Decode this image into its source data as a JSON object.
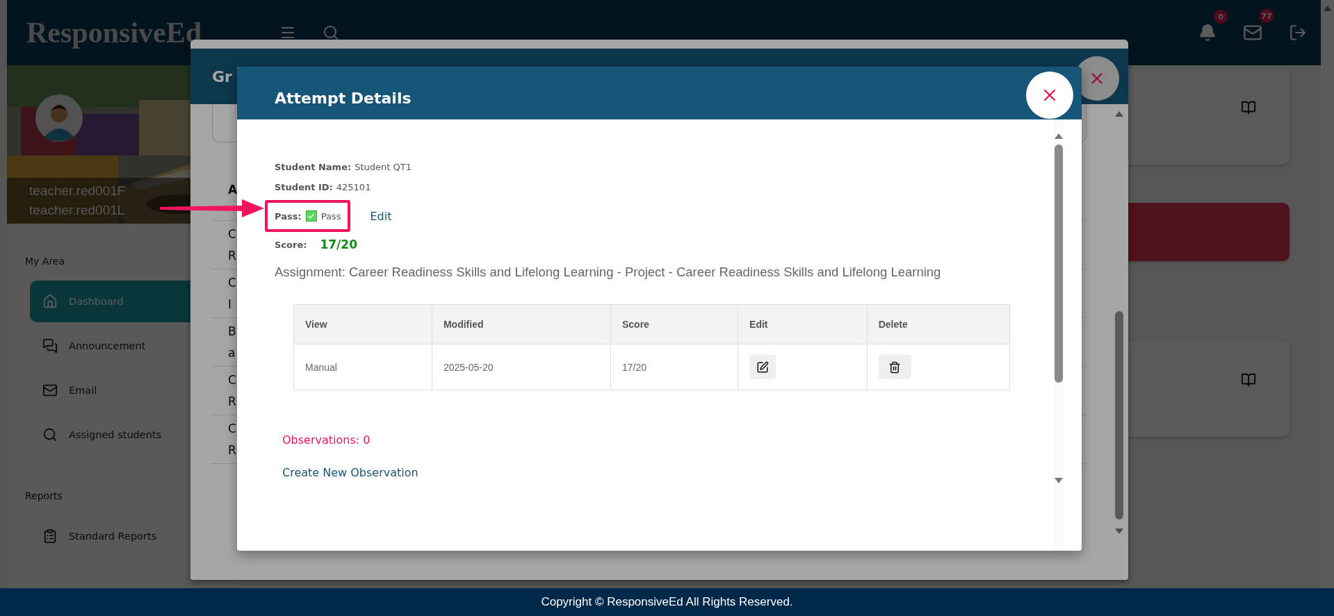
{
  "header": {
    "logo": "ResponsiveEd",
    "notifications": {
      "count": "0"
    },
    "messages": {
      "count": "77"
    }
  },
  "profile": {
    "first_name": "teacher.red001F",
    "last_name": "teacher.red001L"
  },
  "sidebar": {
    "sections": [
      {
        "title": "My Area",
        "items": [
          {
            "label": "Dashboard",
            "selected": true
          },
          {
            "label": "Announcement",
            "selected": false
          },
          {
            "label": "Email",
            "selected": false
          },
          {
            "label": "Assigned students",
            "selected": false
          }
        ]
      },
      {
        "title": "Reports",
        "items": [
          {
            "label": "Standard Reports",
            "selected": false
          }
        ]
      }
    ]
  },
  "dashboard_cards": [
    {
      "kind": "book"
    },
    {
      "kind": "alert"
    },
    {
      "kind": "book"
    }
  ],
  "back_modal": {
    "title": "Gr",
    "column_1_header": "A",
    "rows": [
      {
        "line_1": "C",
        "line_2": "R"
      },
      {
        "line_1": "C",
        "line_2": "I"
      },
      {
        "line_1": "B",
        "line_2": "a"
      },
      {
        "line_1": "C",
        "line_2": "R"
      },
      {
        "line_1": "C",
        "line_2": "R"
      }
    ]
  },
  "attempt_modal": {
    "title": "Attempt Details",
    "student_name_label": "Student Name:",
    "student_name": "Student QT1",
    "student_id_label": "Student ID:",
    "student_id": "425101",
    "pass_label": "Pass:",
    "pass_checked": true,
    "pass_value": "Pass",
    "edit_link": "Edit",
    "score_label": "Score:",
    "score": "17/20",
    "assignment": "Assignment: Career Readiness Skills and Lifelong Learning - Project - Career Readiness Skills and Lifelong Learning",
    "table": {
      "columns": [
        "View",
        "Modified",
        "Score",
        "Edit",
        "Delete"
      ],
      "rows": [
        {
          "view": "Manual",
          "modified": "2025-05-20",
          "score": "17/20"
        }
      ]
    },
    "observations": "Observations: 0",
    "create_observation": "Create New Observation"
  },
  "footer": "Copyright © ResponsiveEd All Rights Reserved."
}
